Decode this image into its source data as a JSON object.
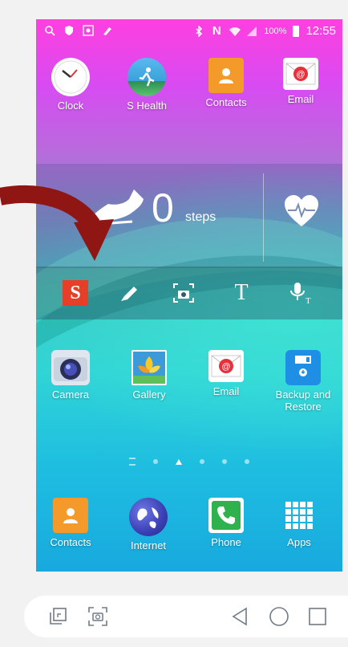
{
  "status_bar": {
    "time": "12:55",
    "battery": "100%",
    "left_icons": [
      "search-icon",
      "shield-icon",
      "gallery-notification-icon",
      "paint-icon"
    ],
    "right_icons": [
      "bluetooth-icon",
      "nfc-icon",
      "wifi-icon",
      "signal-icon"
    ]
  },
  "top_apps": [
    {
      "label": "Clock",
      "icon": "clock-icon"
    },
    {
      "label": "S Health",
      "icon": "s-health-icon"
    },
    {
      "label": "Contacts",
      "icon": "contacts-icon"
    },
    {
      "label": "Email",
      "icon": "email-icon"
    }
  ],
  "widget": {
    "steps_count": "0",
    "steps_label": "steps"
  },
  "toolbar_icons": [
    "s-note-icon",
    "pen-icon",
    "screen-capture-icon",
    "text-icon",
    "voice-to-text-icon"
  ],
  "middle_apps": [
    {
      "label": "Camera",
      "icon": "camera-icon"
    },
    {
      "label": "Gallery",
      "icon": "gallery-icon"
    },
    {
      "label": "Email",
      "icon": "email-icon"
    },
    {
      "label": "Backup and Restore",
      "icon": "backup-restore-icon"
    }
  ],
  "dock_apps": [
    {
      "label": "Contacts",
      "icon": "contacts-icon"
    },
    {
      "label": "Internet",
      "icon": "internet-icon"
    },
    {
      "label": "Phone",
      "icon": "phone-icon"
    },
    {
      "label": "Apps",
      "icon": "apps-grid-icon"
    }
  ],
  "colors": {
    "arrow": "#8f1612",
    "contacts": "#f39a2a",
    "email": "#e8303c",
    "phone": "#2fb24e",
    "s_note": "#e53f2a"
  }
}
